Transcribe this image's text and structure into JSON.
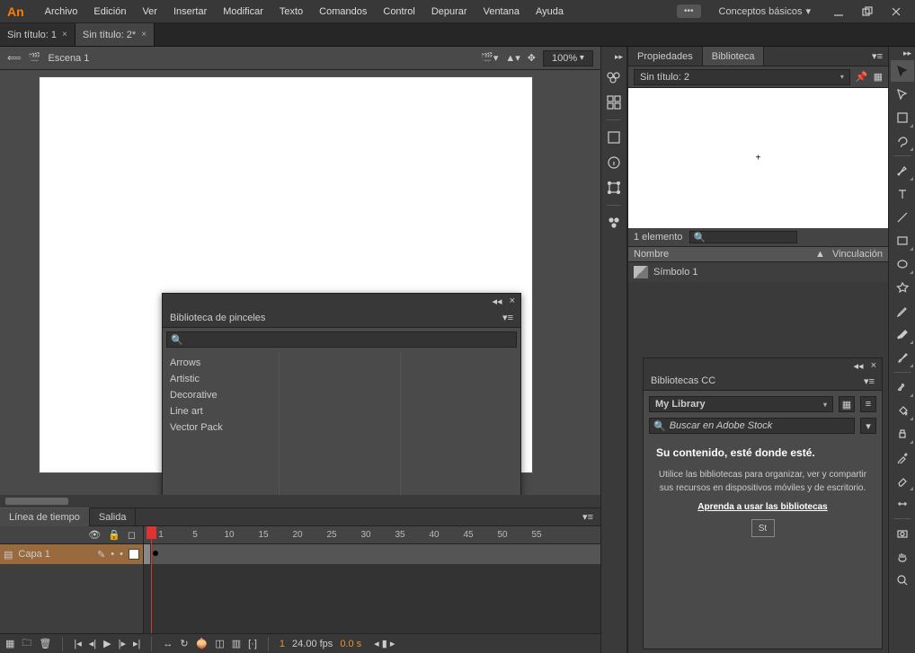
{
  "app": {
    "logo": "An"
  },
  "menu": [
    "Archivo",
    "Edición",
    "Ver",
    "Insertar",
    "Modificar",
    "Texto",
    "Comandos",
    "Control",
    "Depurar",
    "Ventana",
    "Ayuda"
  ],
  "sync_pill": "•••",
  "workspace": "Conceptos básicos",
  "tabs": [
    {
      "label": "Sin título: 1",
      "active": false
    },
    {
      "label": "Sin título: 2*",
      "active": true
    }
  ],
  "stage": {
    "scene": "Escena 1",
    "zoom": "100%"
  },
  "brush_panel": {
    "title": "Biblioteca de pinceles",
    "search_placeholder": "",
    "items": [
      "Arrows",
      "Artistic",
      "Decorative",
      "Line art",
      "Vector Pack"
    ]
  },
  "timeline": {
    "tabs": [
      "Línea de tiempo",
      "Salida"
    ],
    "ruler": [
      "1",
      "5",
      "10",
      "15",
      "20",
      "25",
      "30",
      "35",
      "40",
      "45",
      "50",
      "55"
    ],
    "layer": "Capa 1",
    "status": {
      "frame": "1",
      "fps": "24.00 fps",
      "time": "0.0 s"
    }
  },
  "panels": {
    "tabs": [
      "Propiedades",
      "Biblioteca"
    ],
    "active": 1,
    "doc": "Sin título: 2",
    "count": "1 elemento",
    "columns": [
      "Nombre",
      "Vinculación"
    ],
    "item": "Símbolo 1"
  },
  "cc": {
    "title": "Bibliotecas CC",
    "lib": "My Library",
    "search_placeholder": "Buscar en Adobe Stock",
    "heading": "Su contenido, esté donde esté.",
    "body": "Utilice las bibliotecas para organizar, ver y compartir sus recursos en dispositivos móviles y de escritorio.",
    "link": "Aprenda a usar las bibliotecas",
    "stock": "St"
  }
}
